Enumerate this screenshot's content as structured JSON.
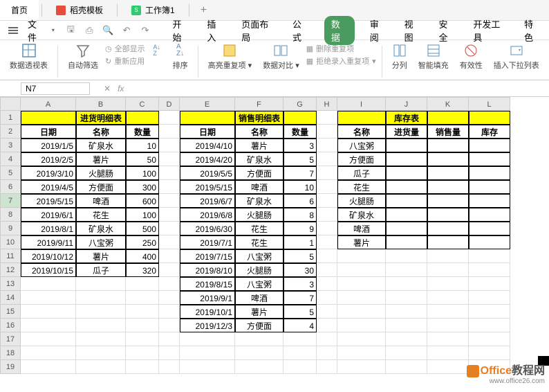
{
  "topTabs": {
    "home": "首页",
    "template": "稻壳模板",
    "workbook": "工作簿1"
  },
  "fileLabel": "文件",
  "ribbonTabs": {
    "start": "开始",
    "insert": "插入",
    "layout": "页面布局",
    "formula": "公式",
    "data": "数据",
    "review": "审阅",
    "view": "视图",
    "security": "安全",
    "dev": "开发工具",
    "special": "特色"
  },
  "ribbonGroups": {
    "pivot": "数据透视表",
    "filter": "自动筛选",
    "showAll": "全部显示",
    "reapply": "重新应用",
    "sort": "排序",
    "highlight": "高亮重复项",
    "compare": "数据对比",
    "delDup": "删除重复项",
    "rejectDup": "拒绝录入重复项",
    "split": "分列",
    "fill": "智能填充",
    "validate": "有效性",
    "dropdown": "插入下拉列表"
  },
  "nameBox": "N7",
  "cols": [
    "A",
    "B",
    "C",
    "D",
    "E",
    "F",
    "G",
    "H",
    "I",
    "J",
    "K",
    "L"
  ],
  "table1": {
    "title": "进货明细表",
    "headers": [
      "日期",
      "名称",
      "数量"
    ],
    "rows": [
      [
        "2019/1/5",
        "矿泉水",
        "10"
      ],
      [
        "2019/2/5",
        "薯片",
        "50"
      ],
      [
        "2019/3/10",
        "火腿肠",
        "100"
      ],
      [
        "2019/4/5",
        "方便面",
        "300"
      ],
      [
        "2019/5/15",
        "啤酒",
        "600"
      ],
      [
        "2019/6/1",
        "花生",
        "100"
      ],
      [
        "2019/8/1",
        "矿泉水",
        "500"
      ],
      [
        "2019/9/11",
        "八宝粥",
        "250"
      ],
      [
        "2019/10/12",
        "薯片",
        "400"
      ],
      [
        "2019/10/15",
        "瓜子",
        "320"
      ]
    ]
  },
  "table2": {
    "title": "销售明细表",
    "headers": [
      "日期",
      "名称",
      "数量"
    ],
    "rows": [
      [
        "2019/4/10",
        "薯片",
        "3"
      ],
      [
        "2019/4/20",
        "矿泉水",
        "5"
      ],
      [
        "2019/5/5",
        "方便面",
        "7"
      ],
      [
        "2019/5/15",
        "啤酒",
        "10"
      ],
      [
        "2019/6/7",
        "矿泉水",
        "6"
      ],
      [
        "2019/6/8",
        "火腿肠",
        "8"
      ],
      [
        "2019/6/30",
        "花生",
        "9"
      ],
      [
        "2019/7/1",
        "花生",
        "1"
      ],
      [
        "2019/7/15",
        "八宝粥",
        "5"
      ],
      [
        "2019/8/10",
        "火腿肠",
        "30"
      ],
      [
        "2019/8/15",
        "八宝粥",
        "3"
      ],
      [
        "2019/9/1",
        "啤酒",
        "7"
      ],
      [
        "2019/10/1",
        "薯片",
        "5"
      ],
      [
        "2019/12/3",
        "方便面",
        "4"
      ]
    ]
  },
  "table3": {
    "title": "库存表",
    "headers": [
      "名称",
      "进货量",
      "销售量",
      "库存"
    ],
    "rows": [
      [
        "八宝粥",
        "",
        "",
        ""
      ],
      [
        "方便面",
        "",
        "",
        ""
      ],
      [
        "瓜子",
        "",
        "",
        ""
      ],
      [
        "花生",
        "",
        "",
        ""
      ],
      [
        "火腿肠",
        "",
        "",
        ""
      ],
      [
        "矿泉水",
        "",
        "",
        ""
      ],
      [
        "啤酒",
        "",
        "",
        ""
      ],
      [
        "薯片",
        "",
        "",
        ""
      ]
    ]
  },
  "watermark": {
    "brand1": "Office",
    "brand2": "教程网",
    "url": "www.office26.com"
  }
}
